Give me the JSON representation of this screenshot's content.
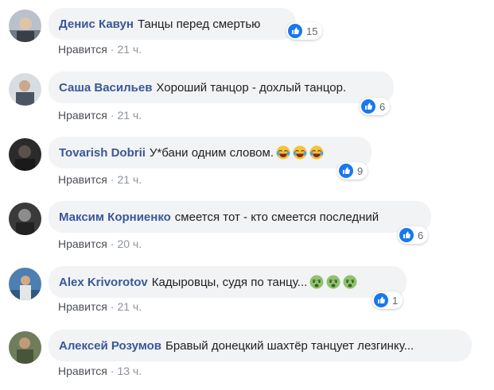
{
  "meta_like_label": "Нравится",
  "meta_separator": "·",
  "comments": [
    {
      "author": "Денис Кавун",
      "text": "Танцы перед смертью",
      "reactions": "15",
      "time": "21 ч.",
      "emojis": []
    },
    {
      "author": "Саша Васильев",
      "text": "Хороший танцор - дохлый танцор.",
      "reactions": "6",
      "time": "21 ч.",
      "emojis": []
    },
    {
      "author": "Tovarish Dobrii",
      "text": "У*бани одним словом.",
      "reactions": "9",
      "time": "21 ч.",
      "emojis": [
        "face-with-tears-of-joy-icon",
        "face-with-tears-of-joy-icon",
        "face-with-tears-of-joy-icon"
      ]
    },
    {
      "author": "Максим Корниенко",
      "text": "смеется тот - кто смеется последний",
      "reactions": "6",
      "time": "20 ч.",
      "emojis": []
    },
    {
      "author": "Alex Krivorotov",
      "text": "Кадыровцы, судя по танцу...",
      "reactions": "1",
      "time": "21 ч.",
      "emojis": [
        "nauseated-face-icon",
        "nauseated-face-icon",
        "nauseated-face-icon"
      ]
    },
    {
      "author": "Алексей Розумов",
      "text": "Бравый донецкий шахтёр танцует лезгинку...",
      "reactions": "",
      "time": "13 ч.",
      "emojis": []
    }
  ],
  "colors": {
    "author": "#385898",
    "bubble": "#f2f3f5",
    "like_blue": "#1877f2",
    "meta": "#8d949e"
  }
}
